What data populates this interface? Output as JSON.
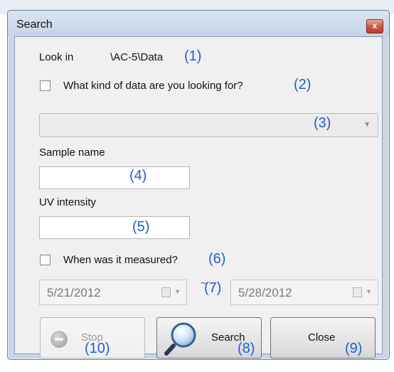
{
  "window": {
    "title": "Search",
    "close_glyph": "x"
  },
  "look_in": {
    "label": "Look in",
    "path": "\\AC-5\\Data",
    "annotation": "(1)"
  },
  "data_kind": {
    "label": "What kind of data are you  looking for?",
    "annotation": "(2)",
    "checked": false
  },
  "data_kind_combo": {
    "value": "",
    "annotation": "(3)"
  },
  "sample_name": {
    "label": "Sample name",
    "value": "",
    "annotation": "(4)"
  },
  "uv_intensity": {
    "label": "UV intensity",
    "value": "",
    "annotation": "(5)"
  },
  "measured": {
    "label": "When was it measured?",
    "annotation": "(6)",
    "checked": false
  },
  "date_range": {
    "from": "5/21/2012",
    "separator": "~",
    "to": "5/28/2012",
    "annotation": "(7)"
  },
  "buttons": {
    "stop": {
      "label": "Stop",
      "annotation": "(10)",
      "icon": "stop-icon"
    },
    "search": {
      "label": "Search",
      "annotation": "(8)",
      "icon": "magnifier-icon"
    },
    "close": {
      "label": "Close",
      "annotation": "(9)"
    }
  },
  "colors": {
    "annotation": "#1f5fcf",
    "client_bg": "#f0f0f0",
    "frame": "#c9d6e6"
  }
}
